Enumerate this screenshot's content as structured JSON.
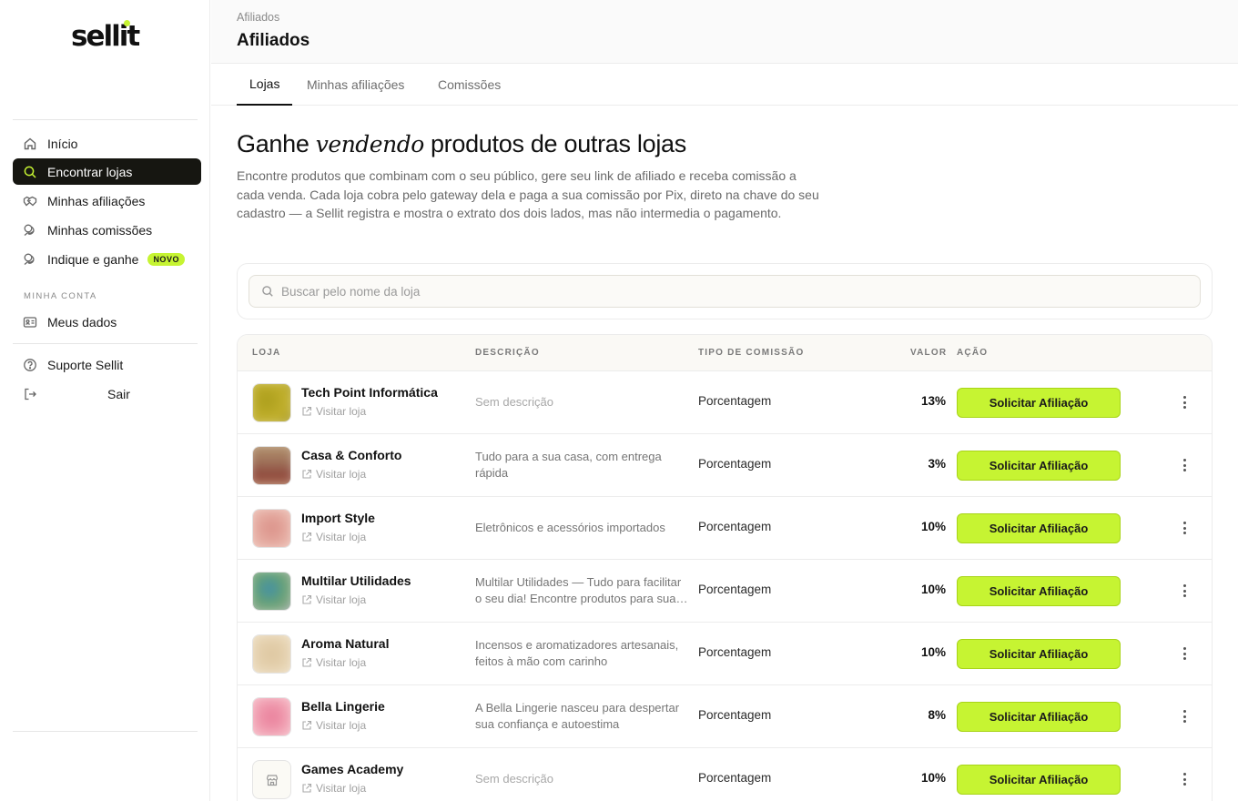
{
  "sidebar": {
    "logo": "sellit",
    "nav": [
      {
        "label": "Início",
        "icon": "home-icon"
      },
      {
        "label": "Encontrar lojas",
        "icon": "search-icon",
        "active": true
      },
      {
        "label": "Minhas afiliações",
        "icon": "handshake-icon"
      },
      {
        "label": "Minhas comissões",
        "icon": "coins-icon"
      },
      {
        "label": "Indique e ganhe",
        "icon": "gift-icon",
        "badge": "NOVO"
      }
    ],
    "section_label": "MINHA CONTA",
    "account": {
      "label": "Meus dados",
      "icon": "id-card-icon"
    },
    "support": {
      "label": "Suporte Sellit",
      "icon": "help-circle-icon"
    },
    "logout": {
      "label": "Sair",
      "icon": "logout-icon"
    }
  },
  "header": {
    "breadcrumb": "Afiliados",
    "title": "Afiliados"
  },
  "tabs": [
    {
      "label": "Lojas",
      "active": true
    },
    {
      "label": "Minhas afiliações"
    },
    {
      "label": "Comissões"
    }
  ],
  "hero": {
    "title_before": "Ganhe ",
    "title_em": "vendendo",
    "title_after": " produtos de outras lojas",
    "description": "Encontre produtos que combinam com o seu público, gere seu link de afiliado e receba comissão a cada venda. Cada loja cobra pelo gateway dela e paga a sua comissão por Pix, direto na chave do seu cadastro — a Sellit registra e mostra o extrato dos dois lados, mas não intermedia o pagamento."
  },
  "search": {
    "placeholder": "Buscar pelo nome da loja"
  },
  "table": {
    "columns": {
      "store": "LOJA",
      "description": "DESCRIÇÃO",
      "commission_type": "TIPO DE COMISSÃO",
      "value": "VALOR",
      "action": "AÇÃO"
    },
    "visit_label": "Visitar loja",
    "action_label": "Solicitar Afiliação",
    "rows": [
      {
        "name": "Tech Point Informática",
        "description": "Sem descrição",
        "commission_type": "Porcentagem",
        "value": "13%"
      },
      {
        "name": "Casa & Conforto",
        "description": "Tudo para a sua casa, com entrega rápida",
        "commission_type": "Porcentagem",
        "value": "3%"
      },
      {
        "name": "Import Style",
        "description": "Eletrônicos e acessórios importados",
        "commission_type": "Porcentagem",
        "value": "10%"
      },
      {
        "name": "Multilar Utilidades",
        "description": "Multilar Utilidades — Tudo para facilitar o seu dia! Encontre produtos para sua casa",
        "commission_type": "Porcentagem",
        "value": "10%"
      },
      {
        "name": "Aroma Natural",
        "description": "Incensos e aromatizadores artesanais, feitos à mão com carinho",
        "commission_type": "Porcentagem",
        "value": "10%"
      },
      {
        "name": "Bella Lingerie",
        "description": "A Bella Lingerie nasceu para despertar sua confiança e autoestima",
        "commission_type": "Porcentagem",
        "value": "8%"
      },
      {
        "name": "Games Academy",
        "description": "Sem descrição",
        "commission_type": "Porcentagem",
        "value": "10%"
      }
    ]
  },
  "colors": {
    "accent": "#c6f432",
    "sidebar_active_bg": "#161611"
  }
}
